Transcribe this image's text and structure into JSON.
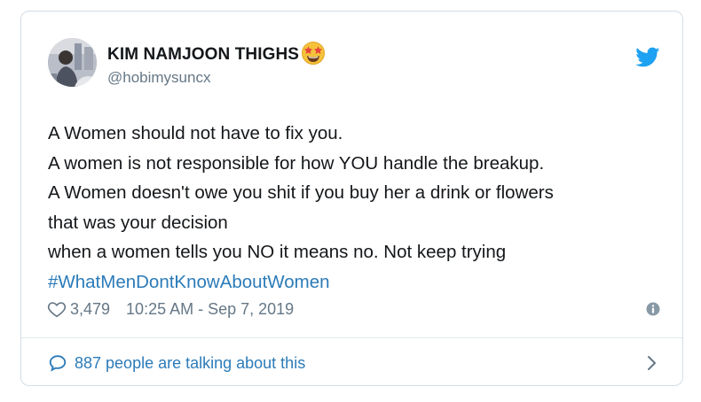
{
  "tweet": {
    "author": {
      "display_name": "KIM NAMJOON THIGHS",
      "handle": "@hobimysuncx",
      "name_emoji": "star-struck-emoji"
    },
    "lines": [
      "A Women should not have to fix you.",
      "A women is not responsible for how YOU handle the breakup.",
      "A Women doesn't owe you shit if you buy her a drink or flowers",
      "that was your decision",
      "when a women tells you NO it means no. Not keep trying"
    ],
    "hashtag": "#WhatMenDontKnowAboutWomen",
    "likes": "3,479",
    "timestamp": "10:25 AM - Sep 7, 2019",
    "conversation_label": "887 people are talking about this"
  },
  "icons": {
    "brand": "twitter-bird-icon",
    "like": "heart-icon",
    "info": "info-icon",
    "reply": "speech-bubble-icon",
    "more": "chevron-right-icon"
  },
  "colors": {
    "twitter_blue": "#1da1f2",
    "link_blue": "#2b7bb9",
    "text": "#14171a",
    "muted": "#657786",
    "border": "#d4dde4"
  }
}
